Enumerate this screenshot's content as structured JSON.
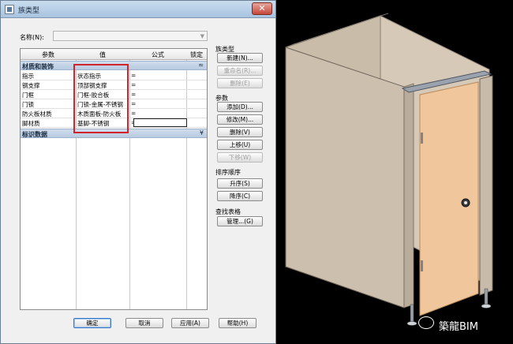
{
  "window": {
    "title": "族类型"
  },
  "name_field": {
    "label": "名称(N):",
    "value": ""
  },
  "table": {
    "headers": [
      "参数",
      "值",
      "公式",
      "锁定"
    ],
    "groups": [
      {
        "name": "材质和装饰",
        "toggle": "≈",
        "rows": [
          {
            "param": "指示",
            "value": "状态指示",
            "formula": "="
          },
          {
            "param": "钢支撑",
            "value": "顶部钢支撑",
            "formula": "="
          },
          {
            "param": "门框",
            "value": "门框-胶合板",
            "formula": "="
          },
          {
            "param": "门锁",
            "value": "门锁-金属-不锈钢",
            "formula": "="
          },
          {
            "param": "防火板材质",
            "value": "木质面板-防火板",
            "formula": "="
          },
          {
            "param": "脚材质",
            "value": "基脚-不锈钢",
            "formula": "="
          }
        ]
      },
      {
        "name": "标识数据",
        "toggle": "¥",
        "rows": []
      }
    ]
  },
  "side_panel": {
    "family_types_label": "族类型",
    "new_button": "新建(N)...",
    "rename_button": "重命名(R)...",
    "delete_type_button": "删除(E)",
    "params_label": "参数",
    "add_button": "添加(D)...",
    "modify_button": "修改(M)...",
    "remove_button": "删除(V)",
    "move_up_button": "上移(U)",
    "move_down_button": "下移(W)",
    "sort_label": "排序顺序",
    "ascending_button": "升序(S)",
    "descending_button": "降序(C)",
    "lookup_label": "查找表格",
    "manage_button": "管理...(G)"
  },
  "footer": {
    "ok": "确定",
    "cancel": "取消",
    "apply": "应用(A)",
    "help": "帮助(H)"
  },
  "viewport": {
    "watermark": "築龍BIM",
    "colors": {
      "panel": "#cdbfae",
      "door": "#f0c79d",
      "background": "#000000"
    }
  }
}
